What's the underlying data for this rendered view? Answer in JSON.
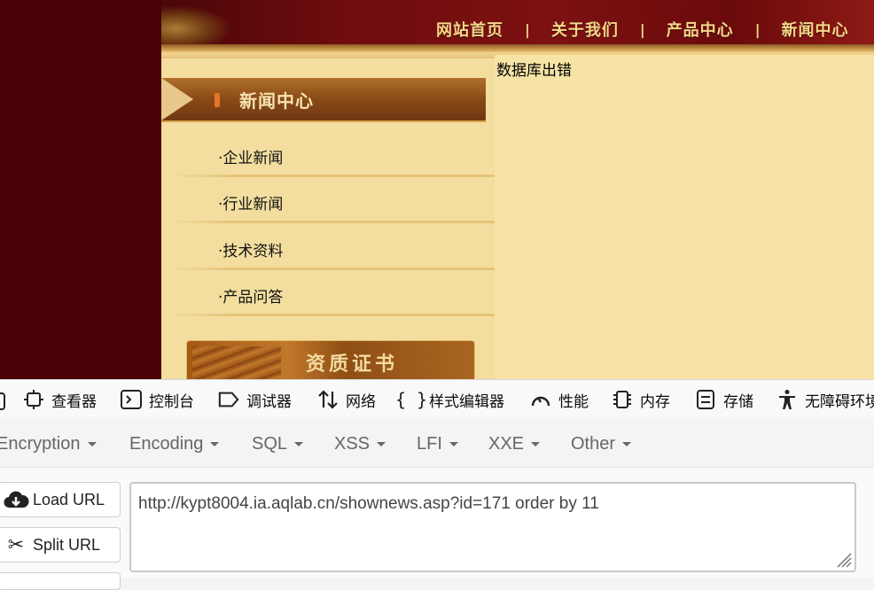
{
  "site": {
    "nav": {
      "home": "网站首页",
      "about": "关于我们",
      "products": "产品中心",
      "news": "新闻中心",
      "separator": "|"
    },
    "sidebar": {
      "title": "新闻中心",
      "items": [
        {
          "label": "·企业新闻"
        },
        {
          "label": "·行业新闻"
        },
        {
          "label": "·技术资料"
        },
        {
          "label": "·产品问答"
        }
      ],
      "cert_banner": "资质证书"
    },
    "content": {
      "error_text": "数据库出错"
    },
    "colors": {
      "page_bg": "#4a0005",
      "banner": "#7d1112",
      "nav_text": "#f3d889",
      "sidebar_bg": "#f3dea0",
      "content_bg": "#f6e3a5"
    }
  },
  "devtools": {
    "tabs": [
      {
        "label": "查看器",
        "icon": "inspector-icon"
      },
      {
        "label": "控制台",
        "icon": "console-icon"
      },
      {
        "label": "调试器",
        "icon": "debugger-icon"
      },
      {
        "label": "网络",
        "icon": "network-icon"
      },
      {
        "label": "样式编辑器",
        "icon": "style-editor-icon"
      },
      {
        "label": "性能",
        "icon": "performance-icon"
      },
      {
        "label": "内存",
        "icon": "memory-icon"
      },
      {
        "label": "存储",
        "icon": "storage-icon"
      },
      {
        "label": "无障碍环境",
        "icon": "accessibility-icon"
      }
    ]
  },
  "hackbar": {
    "menus": [
      {
        "label": "Encryption"
      },
      {
        "label": "Encoding"
      },
      {
        "label": "SQL"
      },
      {
        "label": "XSS"
      },
      {
        "label": "LFI"
      },
      {
        "label": "XXE"
      },
      {
        "label": "Other"
      }
    ],
    "load_url": "Load URL",
    "split_url": "Split URL",
    "url_value": "http://kypt8004.ia.aqlab.cn/shownews.asp?id=171 order by 11"
  }
}
